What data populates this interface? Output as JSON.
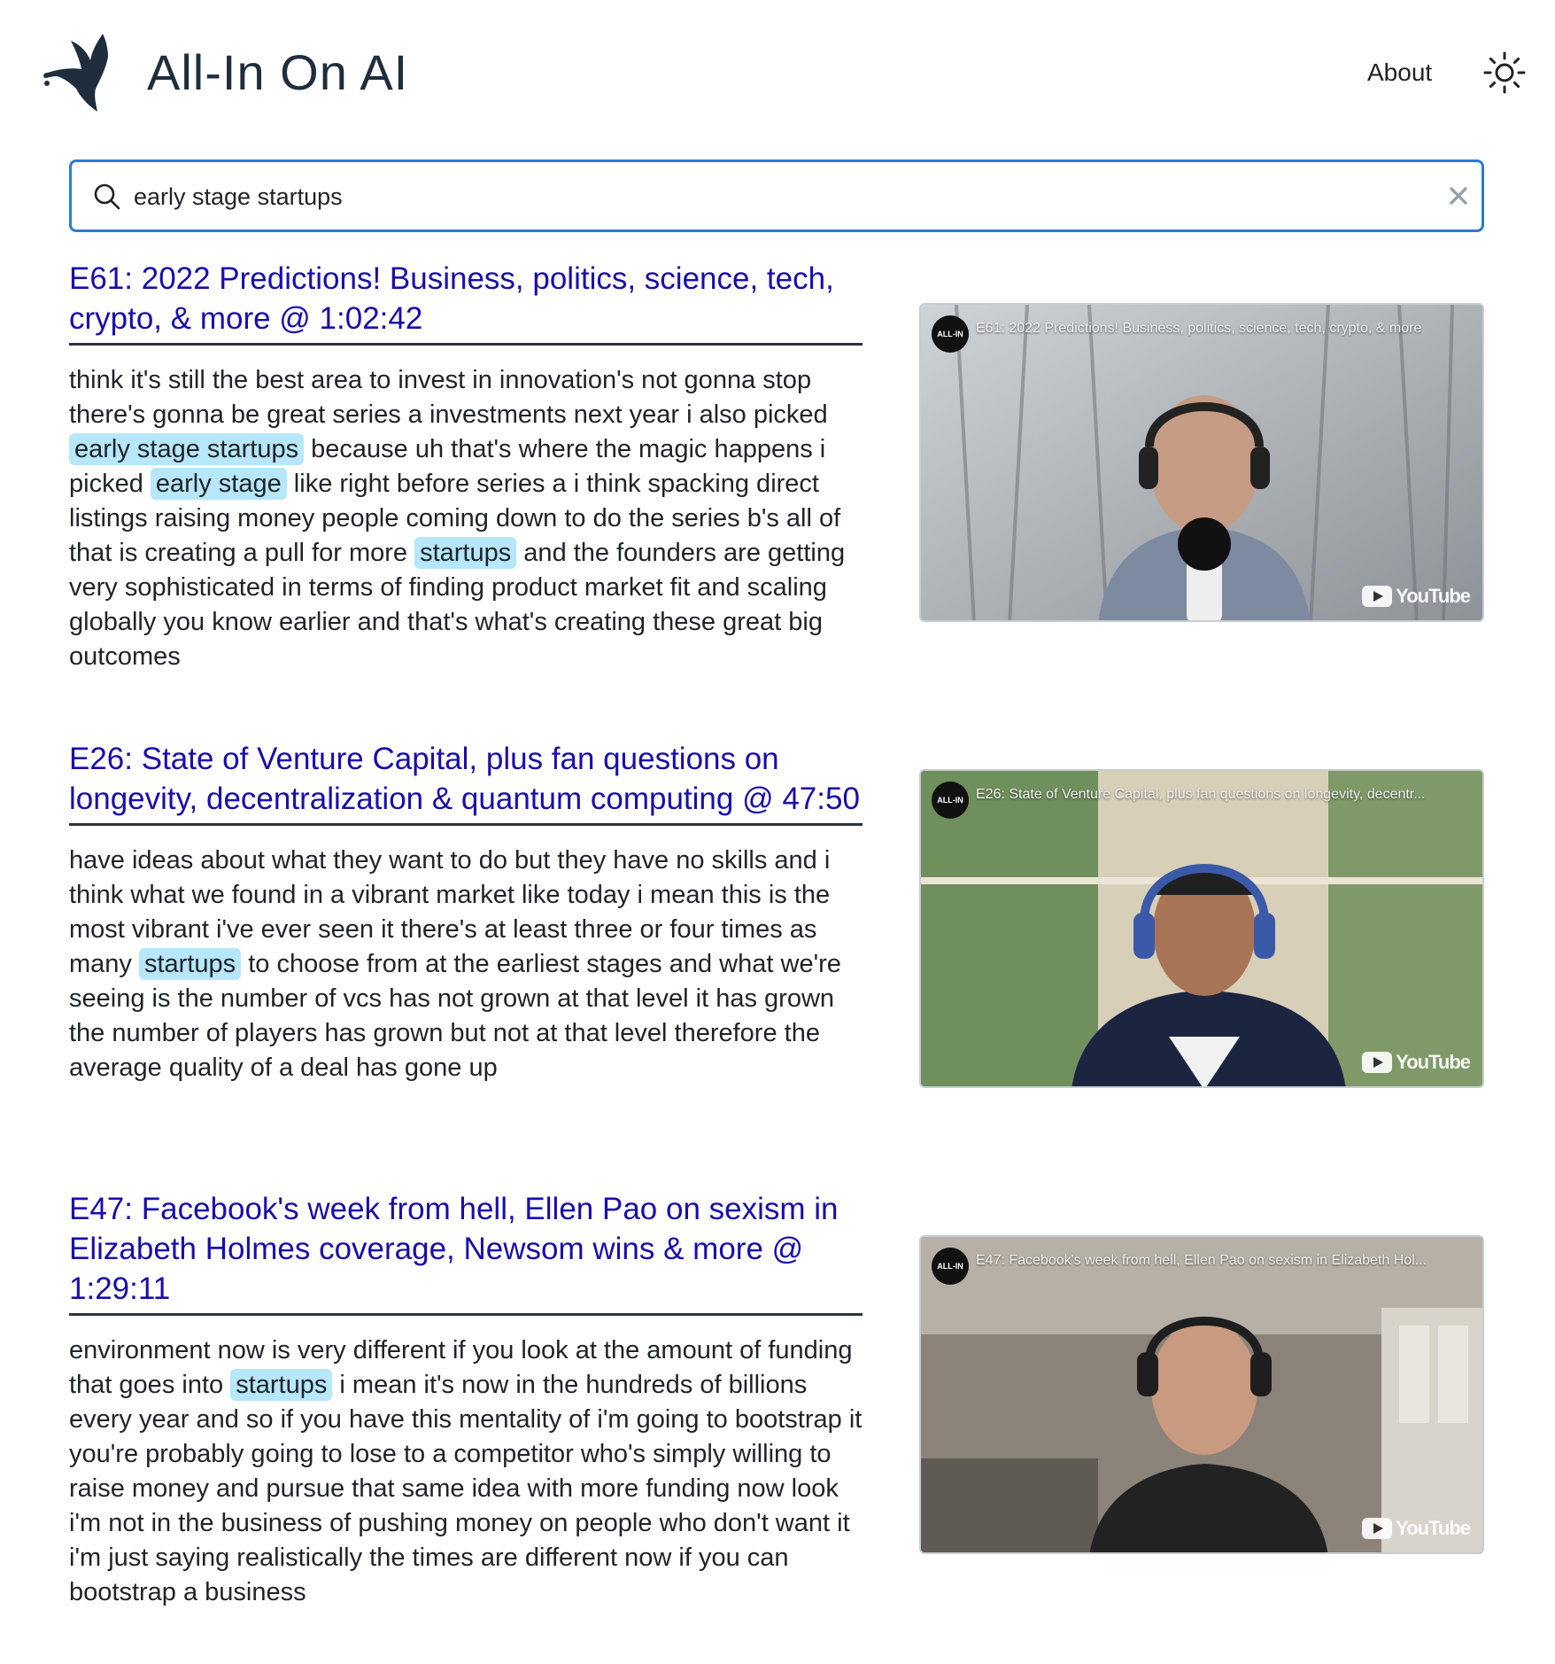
{
  "header": {
    "brand": "All-In On AI",
    "about_label": "About",
    "logo_icon": "bird-logo-icon",
    "theme_icon": "sun-icon"
  },
  "search": {
    "value": "early stage startups",
    "search_icon": "search-icon",
    "clear_icon": "close-icon"
  },
  "results": [
    {
      "title": "E61: 2022 Predictions! Business, politics, science, tech, crypto, & more @ 1:02:42",
      "video_title": "E61: 2022 Predictions! Business, politics, science, tech, crypto, & more",
      "channel_badge": "ALL-IN",
      "video_brand": "YouTube",
      "segments": [
        {
          "text": "think it's still the best area to invest in innovation's not gonna stop there's gonna be great series a investments next year i also picked ",
          "hl": false
        },
        {
          "text": "early stage startups",
          "hl": true
        },
        {
          "text": " because uh that's where the magic happens i picked ",
          "hl": false
        },
        {
          "text": "early stage",
          "hl": true
        },
        {
          "text": " like right before series a i think spacking direct listings raising money people coming down to do the series b's all of that is creating a pull for more ",
          "hl": false
        },
        {
          "text": "startups",
          "hl": true
        },
        {
          "text": " and the founders are getting very sophisticated in terms of finding product market fit and scaling globally you know earlier and that's what's creating these great big outcomes",
          "hl": false
        }
      ]
    },
    {
      "title": "E26: State of Venture Capital, plus fan questions on longevity, decentralization & quantum computing @ 47:50",
      "video_title": "E26: State of Venture Capital, plus fan questions on longevity, decentr...",
      "channel_badge": "ALL-IN",
      "video_brand": "YouTube",
      "segments": [
        {
          "text": "have ideas about what they want to do but they have no skills and i think what we found in a vibrant market like today i mean this is the most vibrant i've ever seen it there's at least three or four times as many ",
          "hl": false
        },
        {
          "text": "startups",
          "hl": true
        },
        {
          "text": " to choose from at the earliest stages and what we're seeing is the number of vcs has not grown at that level it has grown the number of players has grown but not at that level therefore the average quality of a deal has gone up",
          "hl": false
        }
      ]
    },
    {
      "title": "E47: Facebook's week from hell, Ellen Pao on sexism in Elizabeth Holmes coverage, Newsom wins & more @ 1:29:11",
      "video_title": "E47: Facebook's week from hell, Ellen Pao on sexism in Elizabeth Hol...",
      "channel_badge": "ALL-IN",
      "video_brand": "YouTube",
      "segments": [
        {
          "text": "environment now is very different if you look at the amount of funding that goes into ",
          "hl": false
        },
        {
          "text": "startups",
          "hl": true
        },
        {
          "text": " i mean it's now in the hundreds of billions every year and so if you have this mentality of i'm going to bootstrap it you're probably going to lose to a competitor who's simply willing to raise money and pursue that same idea with more funding now look i'm not in the business of pushing money on people who don't want it i'm just saying realistically the times are different now if you can bootstrap a business",
          "hl": false
        }
      ]
    }
  ],
  "colors": {
    "link": "#1a0dab",
    "highlight": "#b6e7fb",
    "search_border": "#2b7bd6",
    "brand_text": "#1f2d3d"
  }
}
